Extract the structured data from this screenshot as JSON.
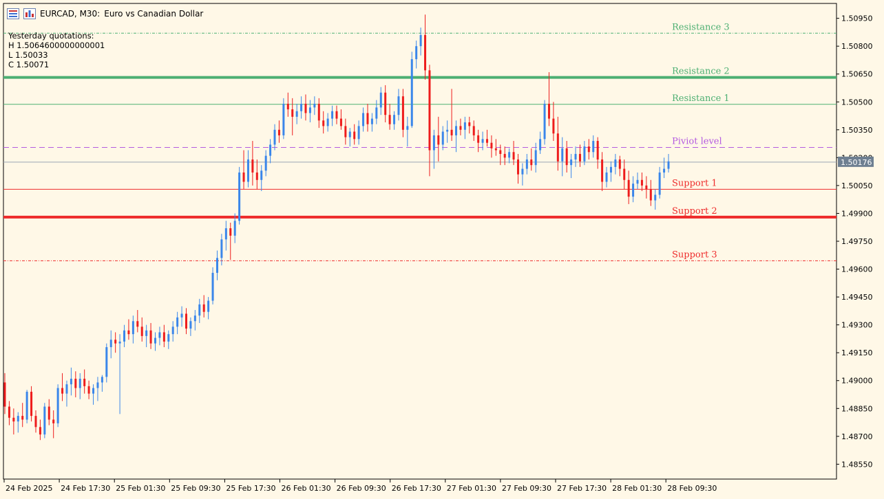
{
  "header": {
    "symbol": "EURCAD, M30:",
    "description": "Euro vs Canadian Dollar",
    "icons": [
      "menu-list-icon",
      "bar-chart-icon"
    ]
  },
  "quotations": {
    "title": "Yesterday quotations:",
    "high": "H 1.5064600000000001",
    "low": "L 1.50033",
    "close": "C 1.50071"
  },
  "current_price": {
    "label": "1.50176",
    "value": 1.50176
  },
  "colors": {
    "background": "#fff8e7",
    "bull": "#3a86ea",
    "bear": "#ee1c1c",
    "resistance": "#4caf72",
    "support": "#ee2b2b",
    "pivot": "#b45ae0",
    "axis": "#000000"
  },
  "chart_data": {
    "type": "candlestick",
    "symbol": "EURCAD",
    "timeframe": "M30",
    "ylim": [
      1.4847,
      1.5103
    ],
    "y_ticks": [
      "1.48550",
      "1.48700",
      "1.48850",
      "1.49000",
      "1.49150",
      "1.49300",
      "1.49450",
      "1.49600",
      "1.49750",
      "1.49900",
      "1.50050",
      "1.50200",
      "1.50350",
      "1.50500",
      "1.50650",
      "1.50800",
      "1.50950"
    ],
    "x_labels": [
      "24 Feb 2025",
      "24 Feb 17:30",
      "25 Feb 01:30",
      "25 Feb 09:30",
      "25 Feb 17:30",
      "26 Feb 01:30",
      "26 Feb 09:30",
      "26 Feb 17:30",
      "27 Feb 01:30",
      "27 Feb 09:30",
      "27 Feb 17:30",
      "28 Feb 01:30",
      "28 Feb 09:30"
    ],
    "levels": [
      {
        "name": "Resistance 3",
        "value": 1.5087,
        "style": "dashdot",
        "width": 1,
        "kind": "resistance"
      },
      {
        "name": "Resistance 2",
        "value": 1.50632,
        "style": "solid",
        "width": 4,
        "kind": "resistance"
      },
      {
        "name": "Resistance 1",
        "value": 1.50487,
        "style": "solid",
        "width": 1,
        "kind": "resistance"
      },
      {
        "name": "Piviot level",
        "value": 1.50255,
        "style": "dashed",
        "width": 1,
        "kind": "pivot"
      },
      {
        "name": "Support 1",
        "value": 1.5003,
        "style": "solid",
        "width": 1,
        "kind": "support"
      },
      {
        "name": "Support 2",
        "value": 1.4988,
        "style": "solid",
        "width": 4,
        "kind": "support"
      },
      {
        "name": "Support 3",
        "value": 1.49645,
        "style": "dashdot",
        "width": 1,
        "kind": "support"
      }
    ],
    "ohlc": [
      [
        1.4899,
        1.4904,
        1.4882,
        1.4886
      ],
      [
        1.4886,
        1.4889,
        1.4876,
        1.488
      ],
      [
        1.488,
        1.4885,
        1.4871,
        1.4878
      ],
      [
        1.4878,
        1.4883,
        1.4872,
        1.4881
      ],
      [
        1.4881,
        1.4888,
        1.4875,
        1.4879
      ],
      [
        1.4879,
        1.4895,
        1.4877,
        1.4894
      ],
      [
        1.4894,
        1.4897,
        1.4878,
        1.4881
      ],
      [
        1.4881,
        1.4884,
        1.4872,
        1.4875
      ],
      [
        1.4875,
        1.4879,
        1.4868,
        1.4871
      ],
      [
        1.4871,
        1.4888,
        1.4869,
        1.4886
      ],
      [
        1.4886,
        1.489,
        1.4876,
        1.4879
      ],
      [
        1.4879,
        1.4884,
        1.4869,
        1.4877
      ],
      [
        1.4877,
        1.4898,
        1.4875,
        1.4896
      ],
      [
        1.4896,
        1.4904,
        1.4889,
        1.4893
      ],
      [
        1.4893,
        1.49,
        1.4886,
        1.4898
      ],
      [
        1.4898,
        1.4907,
        1.4892,
        1.4901
      ],
      [
        1.4901,
        1.4905,
        1.4891,
        1.4896
      ],
      [
        1.4896,
        1.4904,
        1.489,
        1.4901
      ],
      [
        1.4901,
        1.4906,
        1.4893,
        1.4897
      ],
      [
        1.4897,
        1.49,
        1.489,
        1.4893
      ],
      [
        1.4893,
        1.4898,
        1.4887,
        1.4896
      ],
      [
        1.4896,
        1.4902,
        1.4889,
        1.4899
      ],
      [
        1.4899,
        1.4903,
        1.4894,
        1.4902
      ],
      [
        1.4902,
        1.492,
        1.4899,
        1.4918
      ],
      [
        1.4918,
        1.4927,
        1.4912,
        1.4922
      ],
      [
        1.4922,
        1.4926,
        1.4915,
        1.492
      ],
      [
        1.492,
        1.4925,
        1.4882,
        1.4921
      ],
      [
        1.4921,
        1.493,
        1.4918,
        1.4927
      ],
      [
        1.4927,
        1.4933,
        1.4922,
        1.4925
      ],
      [
        1.4925,
        1.4935,
        1.492,
        1.4932
      ],
      [
        1.4932,
        1.4938,
        1.4926,
        1.4929
      ],
      [
        1.4929,
        1.4934,
        1.4921,
        1.4924
      ],
      [
        1.4924,
        1.493,
        1.4918,
        1.4927
      ],
      [
        1.4927,
        1.4931,
        1.4917,
        1.492
      ],
      [
        1.492,
        1.4926,
        1.4916,
        1.4923
      ],
      [
        1.4923,
        1.4929,
        1.4919,
        1.4926
      ],
      [
        1.4926,
        1.493,
        1.4918,
        1.4921
      ],
      [
        1.4921,
        1.4927,
        1.4917,
        1.4925
      ],
      [
        1.4925,
        1.4932,
        1.4921,
        1.4929
      ],
      [
        1.4929,
        1.4937,
        1.4925,
        1.4934
      ],
      [
        1.4934,
        1.494,
        1.4929,
        1.4936
      ],
      [
        1.4936,
        1.4939,
        1.4925,
        1.4928
      ],
      [
        1.4928,
        1.4934,
        1.4924,
        1.4932
      ],
      [
        1.4932,
        1.4938,
        1.4927,
        1.4935
      ],
      [
        1.4935,
        1.4944,
        1.4931,
        1.4941
      ],
      [
        1.4941,
        1.4946,
        1.4934,
        1.4937
      ],
      [
        1.4937,
        1.4945,
        1.4933,
        1.4943
      ],
      [
        1.4943,
        1.4961,
        1.4941,
        1.4958
      ],
      [
        1.4958,
        1.497,
        1.4954,
        1.4966
      ],
      [
        1.4966,
        1.4979,
        1.4962,
        1.4976
      ],
      [
        1.4976,
        1.4986,
        1.497,
        1.4982
      ],
      [
        1.4982,
        1.4985,
        1.4965,
        1.4978
      ],
      [
        1.4978,
        1.499,
        1.4974,
        1.4986
      ],
      [
        1.4986,
        1.5015,
        1.4984,
        1.5012
      ],
      [
        1.5012,
        1.5024,
        1.5003,
        1.5007
      ],
      [
        1.5007,
        1.5024,
        1.5004,
        1.5019
      ],
      [
        1.5019,
        1.5029,
        1.5005,
        1.5012
      ],
      [
        1.5012,
        1.5019,
        1.5003,
        1.5008
      ],
      [
        1.5008,
        1.5016,
        1.5002,
        1.5013
      ],
      [
        1.5013,
        1.5024,
        1.501,
        1.5021
      ],
      [
        1.5021,
        1.503,
        1.5017,
        1.5027
      ],
      [
        1.5027,
        1.5038,
        1.5024,
        1.5035
      ],
      [
        1.5035,
        1.504,
        1.5028,
        1.5032
      ],
      [
        1.5032,
        1.5052,
        1.503,
        1.5049
      ],
      [
        1.5049,
        1.5055,
        1.5042,
        1.5046
      ],
      [
        1.5046,
        1.5052,
        1.5032,
        1.5042
      ],
      [
        1.5042,
        1.5049,
        1.5038,
        1.5045
      ],
      [
        1.5045,
        1.5053,
        1.5041,
        1.5049
      ],
      [
        1.5049,
        1.5054,
        1.504,
        1.5044
      ],
      [
        1.5044,
        1.5051,
        1.5039,
        1.5047
      ],
      [
        1.5047,
        1.5053,
        1.5043,
        1.5049
      ],
      [
        1.5049,
        1.5052,
        1.5036,
        1.504
      ],
      [
        1.504,
        1.5045,
        1.5033,
        1.5037
      ],
      [
        1.5037,
        1.5044,
        1.5034,
        1.5041
      ],
      [
        1.5041,
        1.5048,
        1.5037,
        1.5045
      ],
      [
        1.5045,
        1.5048,
        1.5038,
        1.5041
      ],
      [
        1.5041,
        1.5046,
        1.5035,
        1.5037
      ],
      [
        1.5037,
        1.5041,
        1.5027,
        1.5031
      ],
      [
        1.5031,
        1.5036,
        1.5026,
        1.5034
      ],
      [
        1.5034,
        1.5038,
        1.5027,
        1.503
      ],
      [
        1.503,
        1.504,
        1.5027,
        1.5037
      ],
      [
        1.5037,
        1.5047,
        1.5034,
        1.5044
      ],
      [
        1.5044,
        1.5049,
        1.5034,
        1.5038
      ],
      [
        1.5038,
        1.5044,
        1.5034,
        1.5041
      ],
      [
        1.5041,
        1.5051,
        1.5038,
        1.5047
      ],
      [
        1.5047,
        1.5058,
        1.5043,
        1.5055
      ],
      [
        1.5055,
        1.5059,
        1.5039,
        1.5043
      ],
      [
        1.5043,
        1.5049,
        1.5035,
        1.5038
      ],
      [
        1.5038,
        1.5045,
        1.5035,
        1.5043
      ],
      [
        1.5043,
        1.5057,
        1.504,
        1.5053
      ],
      [
        1.5053,
        1.5057,
        1.5031,
        1.5035
      ],
      [
        1.5035,
        1.5042,
        1.5026,
        1.5037
      ],
      [
        1.5037,
        1.5077,
        1.5036,
        1.5073
      ],
      [
        1.5073,
        1.5083,
        1.5068,
        1.508
      ],
      [
        1.508,
        1.509,
        1.5075,
        1.5086
      ],
      [
        1.5086,
        1.5097,
        1.5062,
        1.5067
      ],
      [
        1.5067,
        1.507,
        1.501,
        1.5024
      ],
      [
        1.5024,
        1.5035,
        1.5014,
        1.5032
      ],
      [
        1.5032,
        1.5042,
        1.5018,
        1.5027
      ],
      [
        1.5027,
        1.5037,
        1.5024,
        1.5034
      ],
      [
        1.5034,
        1.504,
        1.5028,
        1.5035
      ],
      [
        1.5035,
        1.5057,
        1.5029,
        1.5032
      ],
      [
        1.5032,
        1.504,
        1.5023,
        1.5037
      ],
      [
        1.5037,
        1.5041,
        1.5032,
        1.5035
      ],
      [
        1.5035,
        1.5042,
        1.503,
        1.5039
      ],
      [
        1.5039,
        1.5042,
        1.5033,
        1.5037
      ],
      [
        1.5037,
        1.504,
        1.5029,
        1.5032
      ],
      [
        1.5032,
        1.5035,
        1.5023,
        1.5028
      ],
      [
        1.5028,
        1.5034,
        1.5024,
        1.503
      ],
      [
        1.503,
        1.5035,
        1.5026,
        1.5028
      ],
      [
        1.5028,
        1.5032,
        1.502,
        1.5025
      ],
      [
        1.5025,
        1.503,
        1.5021,
        1.5024
      ],
      [
        1.5024,
        1.5027,
        1.5016,
        1.5022
      ],
      [
        1.5022,
        1.5026,
        1.5016,
        1.502
      ],
      [
        1.502,
        1.5025,
        1.5017,
        1.5023
      ],
      [
        1.5023,
        1.5029,
        1.5016,
        1.5019
      ],
      [
        1.5019,
        1.5022,
        1.5006,
        1.5011
      ],
      [
        1.5011,
        1.5017,
        1.5005,
        1.5014
      ],
      [
        1.5014,
        1.5022,
        1.5011,
        1.5019
      ],
      [
        1.5019,
        1.5025,
        1.5013,
        1.5016
      ],
      [
        1.5016,
        1.5028,
        1.5012,
        1.5024
      ],
      [
        1.5024,
        1.5034,
        1.5022,
        1.503
      ],
      [
        1.503,
        1.5051,
        1.5027,
        1.5049
      ],
      [
        1.5049,
        1.5066,
        1.5037,
        1.5041
      ],
      [
        1.5041,
        1.505,
        1.5029,
        1.5033
      ],
      [
        1.5033,
        1.5042,
        1.5013,
        1.5018
      ],
      [
        1.5018,
        1.5031,
        1.501,
        1.5025
      ],
      [
        1.5025,
        1.5029,
        1.5012,
        1.5016
      ],
      [
        1.5016,
        1.5022,
        1.5009,
        1.5019
      ],
      [
        1.5019,
        1.5026,
        1.5015,
        1.5022
      ],
      [
        1.5022,
        1.5027,
        1.5015,
        1.5018
      ],
      [
        1.5018,
        1.5029,
        1.5016,
        1.5026
      ],
      [
        1.5026,
        1.503,
        1.5019,
        1.5023
      ],
      [
        1.5023,
        1.5032,
        1.502,
        1.5029
      ],
      [
        1.5029,
        1.5031,
        1.5014,
        1.5019
      ],
      [
        1.5019,
        1.5023,
        1.5002,
        1.5007
      ],
      [
        1.5007,
        1.5015,
        1.5004,
        1.5012
      ],
      [
        1.5012,
        1.5018,
        1.5007,
        1.5015
      ],
      [
        1.5015,
        1.5022,
        1.5011,
        1.5019
      ],
      [
        1.5019,
        1.5021,
        1.501,
        1.5014
      ],
      [
        1.5014,
        1.5019,
        1.5003,
        1.5008
      ],
      [
        1.5008,
        1.5013,
        1.4995,
        1.4999
      ],
      [
        1.4999,
        1.501,
        1.4996,
        1.5006
      ],
      [
        1.5006,
        1.5012,
        1.5003,
        1.5008
      ],
      [
        1.5008,
        1.5012,
        1.5002,
        1.5005
      ],
      [
        1.5005,
        1.501,
        1.4998,
        1.5003
      ],
      [
        1.5003,
        1.5008,
        1.4994,
        1.4997
      ],
      [
        1.4997,
        1.5003,
        1.4992,
        1.5
      ],
      [
        1.5,
        1.5015,
        1.4998,
        1.5012
      ],
      [
        1.5012,
        1.502,
        1.5009,
        1.5014
      ],
      [
        1.5014,
        1.5022,
        1.5012,
        1.5018
      ]
    ]
  }
}
